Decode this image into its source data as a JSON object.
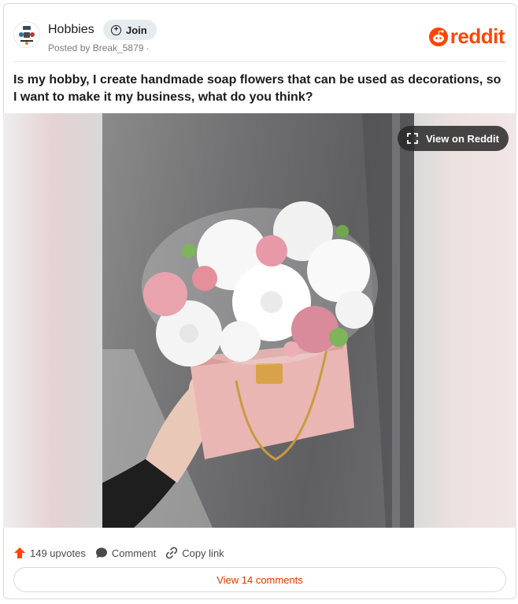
{
  "header": {
    "subreddit": "Hobbies",
    "join_label": "Join",
    "posted_by": "Posted by Break_5879 ·",
    "brand": "reddit"
  },
  "post": {
    "title": "Is my hobby, I create handmade soap flowers that can be used as decorations, so I want to make it my business, what do you think?"
  },
  "media": {
    "view_label": "View on Reddit"
  },
  "footer": {
    "upvotes": "149 upvotes",
    "comment_label": "Comment",
    "copy_label": "Copy link",
    "view_comments": "View 14 comments"
  },
  "colors": {
    "brand": "#ff4500",
    "link": "#d93a00",
    "join_bg": "#e6ebef"
  },
  "icons": [
    "subreddit-logo-icon",
    "plus-circle-icon",
    "reddit-snoo-icon",
    "expand-icon",
    "upvote-arrow-icon",
    "comment-bubble-icon",
    "link-icon"
  ]
}
